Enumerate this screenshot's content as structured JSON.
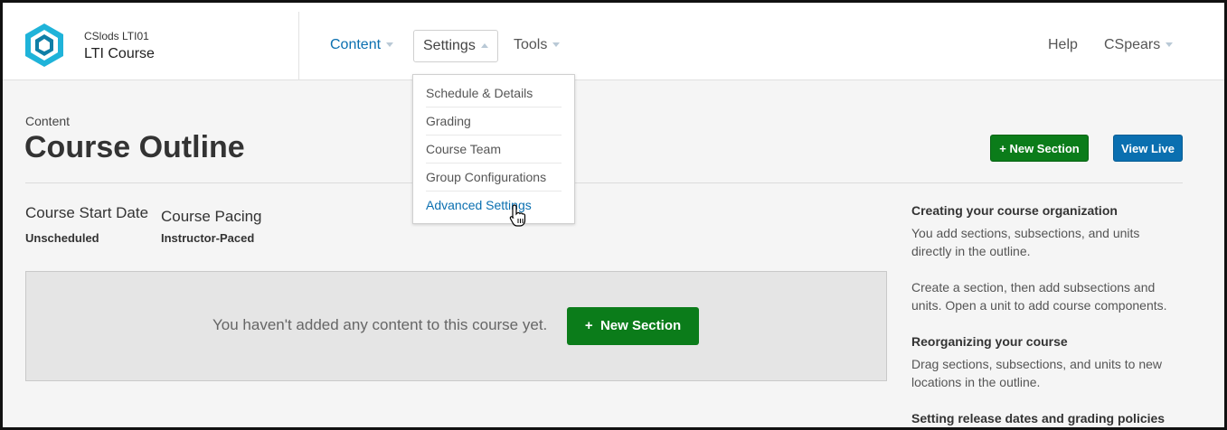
{
  "header": {
    "org": "CSlods  LTI01",
    "course_title": "LTI Course",
    "nav": {
      "content": "Content",
      "settings": "Settings",
      "tools": "Tools",
      "help": "Help",
      "user": "CSpears"
    }
  },
  "settings_menu": {
    "items": [
      "Schedule & Details",
      "Grading",
      "Course Team",
      "Group Configurations",
      "Advanced Settings"
    ]
  },
  "page": {
    "eyebrow": "Content",
    "title": "Course Outline",
    "new_section_label": "New Section",
    "view_live_label": "View Live",
    "start_date_label": "Course Start Date",
    "start_date_value": "Unscheduled",
    "pacing_label": "Course Pacing",
    "pacing_value": "Instructor-Paced",
    "empty_message": "You haven't added any content to this course yet.",
    "empty_button_label": "New Section"
  },
  "help": {
    "h1": "Creating your course organization",
    "p1": "You add sections, subsections, and units directly in the outline.",
    "p2": "Create a section, then add subsections and units. Open a unit to add course components.",
    "h2": "Reorganizing your course",
    "p3": "Drag sections, subsections, and units to new locations in the outline.",
    "h3": "Setting release dates and grading policies"
  },
  "colors": {
    "accent_blue": "#0a6fb0",
    "success_green": "#0b7c1a"
  }
}
